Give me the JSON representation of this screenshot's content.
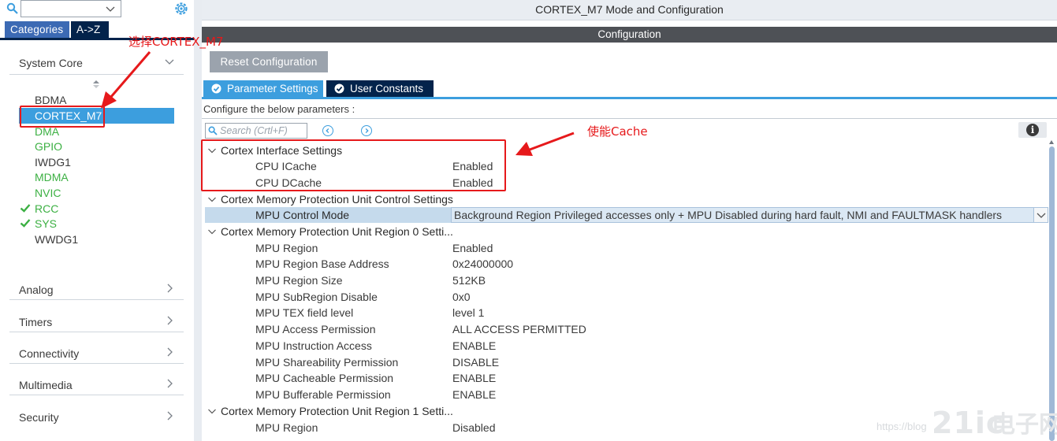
{
  "left_panel": {
    "tabs": {
      "categories": "Categories",
      "az": "A->Z"
    },
    "categories": [
      {
        "label": "System Core",
        "expanded": true
      },
      {
        "label": "Analog",
        "expanded": false
      },
      {
        "label": "Timers",
        "expanded": false
      },
      {
        "label": "Connectivity",
        "expanded": false
      },
      {
        "label": "Multimedia",
        "expanded": false
      },
      {
        "label": "Security",
        "expanded": false
      }
    ],
    "components": [
      {
        "name": "BDMA",
        "status": "none"
      },
      {
        "name": "CORTEX_M7",
        "status": "selected"
      },
      {
        "name": "DMA",
        "status": "available"
      },
      {
        "name": "GPIO",
        "status": "available"
      },
      {
        "name": "IWDG1",
        "status": "none"
      },
      {
        "name": "MDMA",
        "status": "available"
      },
      {
        "name": "NVIC",
        "status": "available"
      },
      {
        "name": "RCC",
        "status": "configured"
      },
      {
        "name": "SYS",
        "status": "configured"
      },
      {
        "name": "WWDG1",
        "status": "none"
      }
    ]
  },
  "right_panel": {
    "mode_title": "CORTEX_M7 Mode and Configuration",
    "configuration_label": "Configuration",
    "reset_button": "Reset Configuration",
    "tabs": {
      "parameter_settings": "Parameter Settings",
      "user_constants": "User Constants"
    },
    "configure_text": "Configure the below parameters :",
    "search_placeholder": "Search (Crtl+F)",
    "groups": [
      {
        "title": "Cortex Interface Settings",
        "params": [
          {
            "name": "CPU ICache",
            "value": "Enabled"
          },
          {
            "name": "CPU DCache",
            "value": "Enabled"
          }
        ]
      },
      {
        "title": "Cortex Memory Protection Unit Control Settings",
        "params": [
          {
            "name": "MPU Control Mode",
            "value": "Background Region Privileged accesses only + MPU Disabled during hard fault, NMI and FAULTMASK handlers"
          }
        ]
      },
      {
        "title": "Cortex Memory Protection Unit Region 0 Setti...",
        "params": [
          {
            "name": "MPU Region",
            "value": "Enabled"
          },
          {
            "name": "MPU Region Base Address",
            "value": "0x24000000"
          },
          {
            "name": "MPU Region Size",
            "value": "512KB"
          },
          {
            "name": "MPU SubRegion Disable",
            "value": "0x0"
          },
          {
            "name": "MPU TEX field level",
            "value": "level 1"
          },
          {
            "name": "MPU Access Permission",
            "value": "ALL ACCESS PERMITTED"
          },
          {
            "name": "MPU Instruction Access",
            "value": "ENABLE"
          },
          {
            "name": "MPU Shareability Permission",
            "value": "DISABLE"
          },
          {
            "name": "MPU Cacheable Permission",
            "value": "ENABLE"
          },
          {
            "name": "MPU Bufferable  Permission",
            "value": "ENABLE"
          }
        ]
      },
      {
        "title": "Cortex Memory Protection Unit Region 1 Setti...",
        "params": [
          {
            "name": "MPU Region",
            "value": "Disabled"
          }
        ]
      }
    ]
  },
  "annotations": {
    "select_note": "选择CORTEX_M7",
    "cache_note": "使能Cache"
  },
  "watermark": {
    "url": "https://blog",
    "logo": "21ic",
    "cn": "电子网"
  },
  "colors": {
    "accent_blue": "#3c9ede",
    "dark_navy": "#03234b",
    "configured_green": "#3cb043",
    "annotation_red": "#e6191b"
  }
}
